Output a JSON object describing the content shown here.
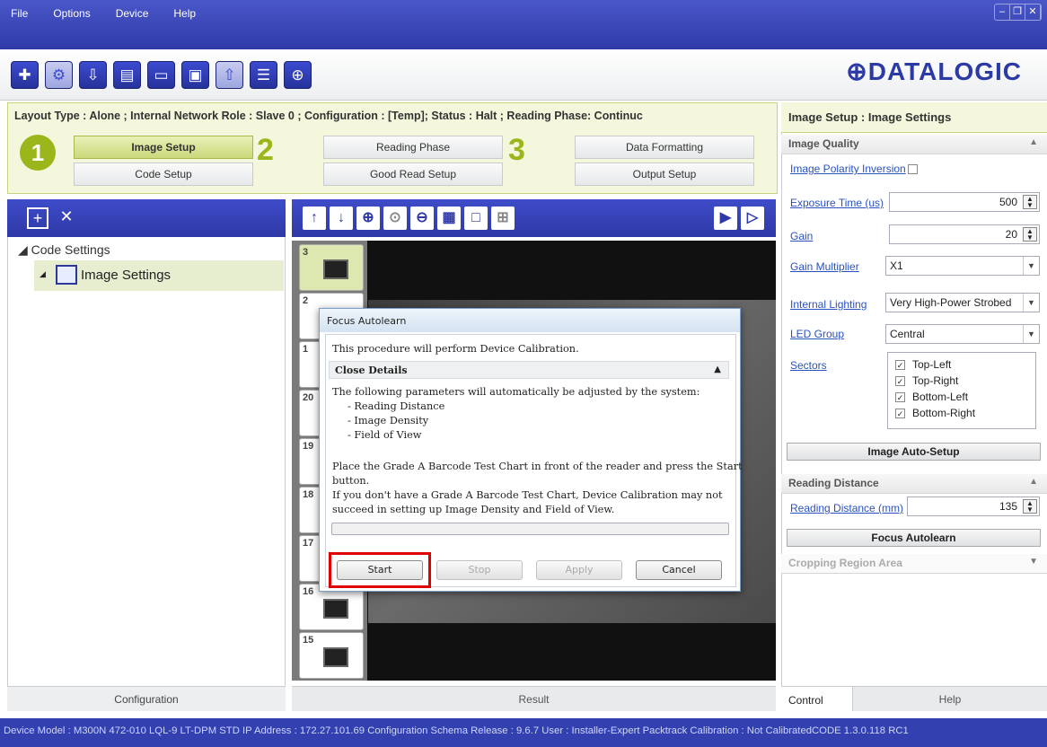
{
  "menu": {
    "file": "File",
    "options": "Options",
    "device": "Device",
    "help": "Help"
  },
  "window_controls": {
    "minimize": "–",
    "restore": "❐",
    "close": "✕"
  },
  "brand": "⊕DATALOGIC",
  "status_line": "Layout Type : Alone ; Internal Network Role : Slave 0 ; Configuration : [Temp]; Status : Halt ; Reading Phase: Continuc",
  "wizard": {
    "step1": "1",
    "step2": "2",
    "step3": "3",
    "image_setup": "Image Setup",
    "code_setup": "Code Setup",
    "reading_phase": "Reading Phase",
    "good_read_setup": "Good Read Setup",
    "data_formatting": "Data Formatting",
    "output_setup": "Output Setup"
  },
  "tree": {
    "root": "◢ Code Settings",
    "child": "Image Settings"
  },
  "left_footer": "Configuration",
  "result_tab": "Result",
  "thumbs": [
    "3",
    "2",
    "1",
    "20",
    "19",
    "18",
    "17",
    "16",
    "15"
  ],
  "right": {
    "title": "Image Setup : Image Settings",
    "image_quality": "Image Quality",
    "polarity": "Image Polarity Inversion",
    "exposure_label": "Exposure Time (us)",
    "exposure_value": "500",
    "gain_label": "Gain",
    "gain_value": "20",
    "gain_mult_label": "Gain Multiplier",
    "gain_mult_value": "X1",
    "lighting_label": "Internal Lighting",
    "lighting_value": "Very High-Power Strobed",
    "led_label": "LED Group",
    "led_value": "Central",
    "sectors_label": "Sectors",
    "sectors": [
      "Top-Left",
      "Top-Right",
      "Bottom-Left",
      "Bottom-Right"
    ],
    "auto_setup": "Image Auto-Setup",
    "reading_distance": "Reading Distance",
    "rd_label": "Reading Distance (mm)",
    "rd_value": "135",
    "focus_autolearn": "Focus Autolearn",
    "cropping": "Cropping Region Area",
    "control_tab": "Control",
    "help_tab": "Help"
  },
  "dialog": {
    "title": "Focus Autolearn",
    "intro": "This procedure will perform Device Calibration.",
    "close_details": "Close Details",
    "line1": "The following parameters will automatically be adjusted by the system:",
    "line2": "- Reading Distance",
    "line3": "- Image Density",
    "line4": "- Field of View",
    "line5": "Place the Grade A Barcode Test Chart in front of the reader and press the Start",
    "line6": "button.",
    "line7": "If you don't have a Grade A Barcode Test Chart, Device Calibration may not",
    "line8": "succeed in setting up Image Density and Field of View.",
    "start": "Start",
    "stop": "Stop",
    "apply": "Apply",
    "cancel": "Cancel"
  },
  "statusbar": "Device Model : M300N 472-010 LQL-9 LT-DPM STD   IP Address : 172.27.101.69   Configuration Schema Release : 9.6.7   User : Installer-Expert   Packtrack Calibration : Not CalibratedCODE 1.3.0.118 RC1",
  "colors": {
    "title_bar": "#2f3aa8",
    "accent_green": "#9ab61a",
    "highlight": "#e00000"
  }
}
